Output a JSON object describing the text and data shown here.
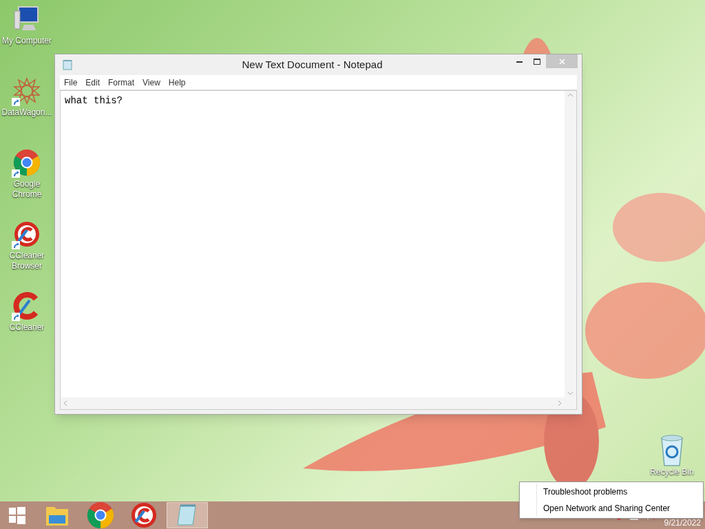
{
  "desktop_icons": [
    {
      "kind": "computer",
      "label": "My Computer",
      "shortcut": false
    },
    {
      "kind": "star",
      "label": "DataWagon...",
      "shortcut": true
    },
    {
      "kind": "chrome",
      "label": "Google Chrome",
      "shortcut": true
    },
    {
      "kind": "ccleaner-browser",
      "label": "CCleaner Browser",
      "shortcut": true
    },
    {
      "kind": "ccleaner",
      "label": "CCleaner",
      "shortcut": true
    }
  ],
  "recycle_bin": {
    "label": "Recycle Bin"
  },
  "window": {
    "title": "New Text Document - Notepad",
    "menu": [
      "File",
      "Edit",
      "Format",
      "View",
      "Help"
    ],
    "text": "what this?"
  },
  "taskbar": {
    "items": [
      {
        "kind": "start",
        "selected": false
      },
      {
        "kind": "explorer",
        "selected": false
      },
      {
        "kind": "chrome",
        "selected": false
      },
      {
        "kind": "ccleaner-browser",
        "selected": false
      },
      {
        "kind": "notepad",
        "selected": true
      }
    ],
    "date": "9/21/2022"
  },
  "context_menu": {
    "items": [
      "Troubleshoot problems",
      "Open Network and Sharing Center"
    ]
  }
}
